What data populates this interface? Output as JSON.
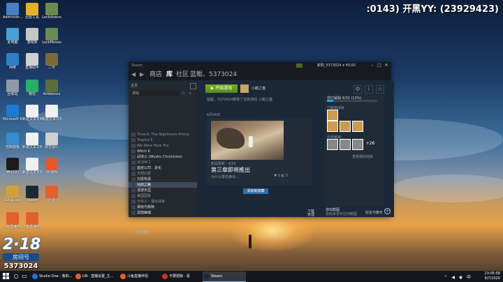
{
  "overlay": {
    "channel_text": ":0143) 开黑YY: (23929423)"
  },
  "channel": {
    "logo": "2·18",
    "logo_sub": "房间号",
    "room": "5373024"
  },
  "desktop_icons": [
    {
      "label": "Administr...",
      "color": "#4b7fc4"
    },
    {
      "label": "迅雷工具",
      "color": "#e3b02a"
    },
    {
      "label": "Lockdowns",
      "color": "#6b8a52"
    },
    {
      "label": "此电脑",
      "color": "#4b9fd8"
    },
    {
      "label": "游戏库",
      "color": "#c6c6c6"
    },
    {
      "label": "LockMoves",
      "color": "#6b8a52"
    },
    {
      "label": "网络",
      "color": "#2d7ec6"
    },
    {
      "label": "直播助手",
      "color": "#d0d0d0"
    },
    {
      "label": "二号",
      "color": "#7a6a3a"
    },
    {
      "label": "回收站",
      "color": "#909aa6"
    },
    {
      "label": "微信",
      "color": "#2aae67"
    },
    {
      "label": "Ambience",
      "color": "#5a6e3a"
    },
    {
      "label": "Microsoft Edge",
      "color": "#1e7ad0"
    },
    {
      "label": "新建文本文档.txt",
      "color": "#f0f0f0"
    },
    {
      "label": "新建文本文档(2).txt",
      "color": "#f0f0f0"
    },
    {
      "label": "控制面板",
      "color": "#3a8ad0"
    },
    {
      "label": "新建文本文档(3).txt",
      "color": "#f0f0f0"
    },
    {
      "label": "双击运行",
      "color": "#cfcfcf"
    },
    {
      "label": "腾讯QQ",
      "color": "#1b1b1b"
    },
    {
      "label": "新建文本文档(4).txt",
      "color": "#f0f0f0"
    },
    {
      "label": "QQ游戏",
      "color": "#e35a2a"
    },
    {
      "label": "Setup.exe",
      "color": "#d0a040"
    },
    {
      "label": "Steam",
      "color": "#1b2838"
    },
    {
      "label": "迅雷",
      "color": "#e3602a"
    },
    {
      "label": "斗鱼直播伴侣",
      "color": "#e3602a"
    },
    {
      "label": "斗鱼直播伴侣",
      "color": "#e3602a"
    }
  ],
  "steam": {
    "titlebar": {
      "app": "Steam",
      "account": "新购_5373024 ▾ ¥0.00",
      "win_min": "–",
      "win_max": "□",
      "win_close": "✕"
    },
    "nav": {
      "back": "◀",
      "fwd": "▶",
      "store": "商店",
      "library": "库",
      "community": "社区",
      "username": "蓝鲲、5373024"
    },
    "sidebar": {
      "home_label": "主页",
      "filter_label": "游戏",
      "games": [
        {
          "name": "Time-X: The Nightmare Prince",
          "bright": false,
          "selected": false
        },
        {
          "name": "Tropico 5",
          "bright": false,
          "selected": false
        },
        {
          "name": "We Were Here Too",
          "bright": false,
          "selected": false
        },
        {
          "name": "Witch It",
          "bright": true,
          "selected": false
        },
        {
          "name": "武侠乂 (Wushu Chronicles)",
          "bright": true,
          "selected": false
        },
        {
          "name": "XCOM 2",
          "bright": false,
          "selected": false
        },
        {
          "name": "瘟疫公司：进化",
          "bright": true,
          "selected": false
        },
        {
          "name": "无限幻想",
          "bright": false,
          "selected": false
        },
        {
          "name": "扫雷物语",
          "bright": true,
          "selected": false
        },
        {
          "name": "仙剑之路",
          "bright": true,
          "selected": true
        },
        {
          "name": "漫游天涯",
          "bright": true,
          "selected": false
        },
        {
          "name": "美国国家",
          "bright": false,
          "selected": false
        },
        {
          "name": "日本人：退出战争",
          "bright": false,
          "selected": false
        },
        {
          "name": "暴雨与救赎",
          "bright": true,
          "selected": false
        },
        {
          "name": "黑暗幽魂",
          "bright": true,
          "selected": false
        }
      ],
      "add_game": "＋ 添加游戏"
    },
    "main": {
      "play_label": "▶ 开始游戏",
      "friend_label": "小鹏之猫",
      "tool_gear": "⚙",
      "tool_info": "i",
      "tool_star": "☆",
      "activity": "蓝鲲、5373024推荐了这款游戏 小鹏之猫",
      "date": "6月26日",
      "card_meta": "新闻更新 · 4/21",
      "card_title": "第三章即将推出",
      "card_sub": "为什么要先推出...",
      "card_icons": "♥ 0  ◧ 0",
      "blue_btn": "添加到收藏",
      "downloads_l1": "下载",
      "downloads_l2": "管理",
      "friends_chat": "好友与聊天",
      "friends_plus": "+"
    },
    "panel": {
      "achievements_label": "您已解锁 4/32 (13%)",
      "achievements_progress": 0.13,
      "locked_label": "尚未解锁",
      "unlocked_label": "已解锁成就",
      "more_count": "+26",
      "view_all": "查看我的成就",
      "notes_label": "游戏截图",
      "notes_sub": "您尚未发布任何截图"
    }
  },
  "taskbar": {
    "apps": [
      {
        "label": "Studio One - 我的...",
        "color": "#2a6fd0",
        "active": false
      },
      {
        "label": "UN · 直播设置_主...",
        "color": "#e3602a",
        "active": false
      },
      {
        "label": "斗鱼直播伴侣",
        "color": "#e3602a",
        "active": false
      },
      {
        "label": "不要把我 · 喜",
        "color": "#d03030",
        "active": false
      },
      {
        "label": "Steam",
        "color": "#1b2838",
        "active": true
      }
    ],
    "tray_icons": "⌃ ◀ ◉ 中",
    "time": "23:05:58",
    "date": "9/7/2020"
  }
}
